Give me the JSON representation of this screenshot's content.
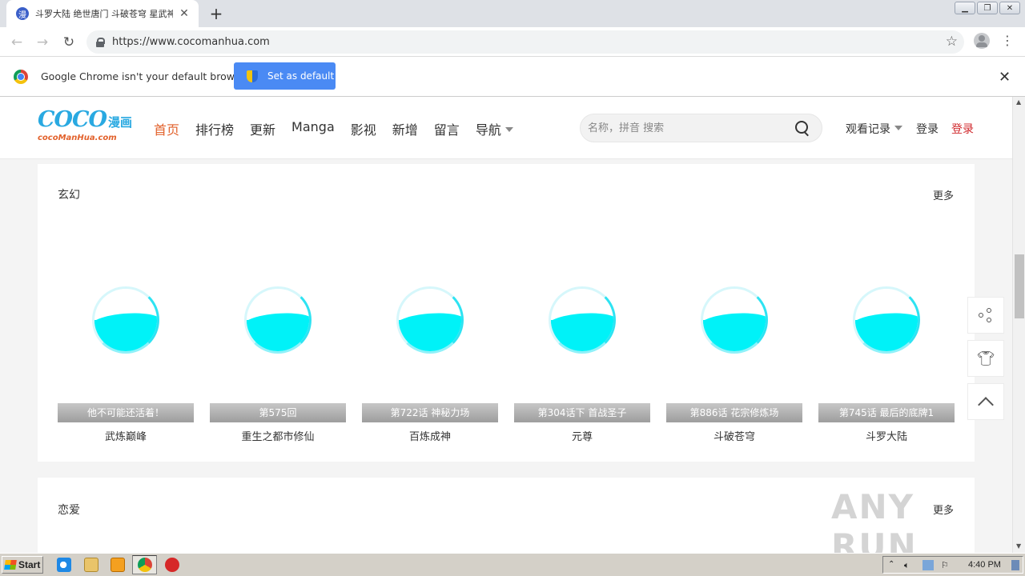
{
  "browser": {
    "tab_title": "斗罗大陆 绝世唐门 斗破苍穹 星武神",
    "tab_favicon_text": "漫",
    "url": "https://www.cocomanhua.com",
    "infobar_text": "Google Chrome isn't your default browser",
    "set_default_label": "Set as default"
  },
  "site": {
    "logo_main": "COCO",
    "logo_cn": "漫画",
    "logo_sub": "cocoManHua.com",
    "nav": [
      {
        "label": "首页",
        "active": true
      },
      {
        "label": "排行榜"
      },
      {
        "label": "更新"
      },
      {
        "label": "Manga"
      },
      {
        "label": "影视"
      },
      {
        "label": "新增"
      },
      {
        "label": "留言"
      },
      {
        "label": "导航"
      }
    ],
    "search_placeholder": "名称，拼音 搜索",
    "history_label": "观看记录",
    "login_label": "登录",
    "register_label": "登录"
  },
  "sections": [
    {
      "title": "玄幻",
      "more": "更多",
      "cards": [
        {
          "update": "他不可能还活着！",
          "title": "武炼巅峰"
        },
        {
          "update": "第575回",
          "title": "重生之都市修仙"
        },
        {
          "update": "第722话 神秘力场",
          "title": "百炼成神"
        },
        {
          "update": "第304话下 首战圣子",
          "title": "元尊"
        },
        {
          "update": "第886话 花宗修炼场",
          "title": "斗破苍穹"
        },
        {
          "update": "第745话 最后的底牌1",
          "title": "斗罗大陆"
        }
      ]
    },
    {
      "title": "恋爱",
      "more": "更多"
    }
  ],
  "watermark": "ANY RUN",
  "taskbar": {
    "start_label": "Start",
    "clock": "4:40 PM"
  },
  "colors": {
    "accent": "#e2612b",
    "brand_blue": "#29a9e1",
    "register_red": "#d0282c",
    "loader_cyan": "#00f2f8",
    "chrome_blue_button": "#4a8af4"
  }
}
